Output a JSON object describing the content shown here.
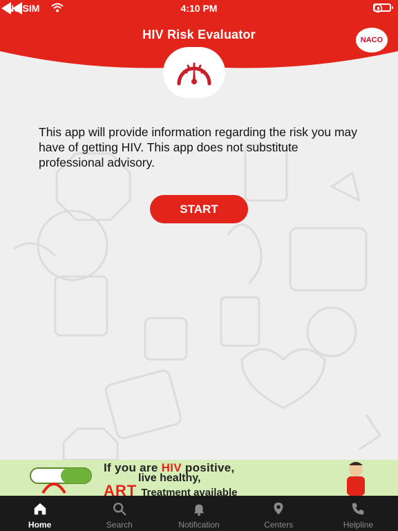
{
  "status_bar": {
    "carrier": "No SIM",
    "time": "4:10 PM",
    "battery_level": 0.15,
    "icons": [
      "wifi-icon",
      "orientation-lock-icon",
      "battery-icon"
    ]
  },
  "header": {
    "title": "HIV Risk Evaluator",
    "back_icon": "double-chevron-left-icon",
    "logo_text": "NACO",
    "center_icon": "speedometer-gauge-icon"
  },
  "main": {
    "info_text": "This app will provide information regarding the risk you may have of getting HIV. This app does not substitute professional advisory.",
    "start_label": "START"
  },
  "banner": {
    "line1_pre": "If you are ",
    "line1_hl": "HIV",
    "line1_post": " positive,",
    "line2": "live healthy,",
    "art": "ART",
    "line3": "Treatment available"
  },
  "tabbar": {
    "tabs": [
      {
        "label": "Home",
        "icon": "home-icon",
        "active": true
      },
      {
        "label": "Search",
        "icon": "search-icon",
        "active": false
      },
      {
        "label": "Notification",
        "icon": "bell-icon",
        "active": false
      },
      {
        "label": "Centers",
        "icon": "map-pin-icon",
        "active": false
      },
      {
        "label": "Helpline",
        "icon": "phone-icon",
        "active": false
      }
    ]
  },
  "colors": {
    "brand_red": "#e3241a",
    "tabbar_bg": "#1a1a1a",
    "banner_bg": "#d6edb8"
  }
}
